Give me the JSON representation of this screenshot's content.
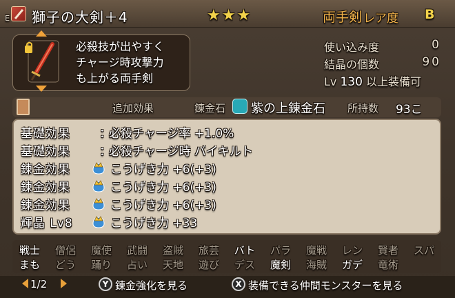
{
  "header": {
    "equip_mark": "E",
    "item_name": "獅子の大剣＋4",
    "stars": "★★★",
    "weapon_type": "両手剣",
    "rarity_label": "レア度",
    "rarity_value": "B"
  },
  "description": {
    "lines": [
      "必殺技が出やすく",
      "チャージ時攻撃力",
      "も上がる両手剣"
    ]
  },
  "stats": {
    "usage_label": "使い込み度",
    "usage_value": "0",
    "crystal_label": "結晶の個数",
    "crystal_value": "90",
    "lv_prefix": "Lv",
    "lv_value": "130",
    "lv_suffix": "以上装備可"
  },
  "alchemy_bar": {
    "tab_label": "追加効果",
    "stone_label": "錬金石",
    "stone_name": "紫の上錬金石",
    "owned_label": "所持数",
    "owned_value": "93こ"
  },
  "effects": [
    {
      "category": "基礎効果",
      "text": "必殺チャージ率 +1.0%",
      "icon": ""
    },
    {
      "category": "基礎効果",
      "text": "必殺チャージ時 バイキルト",
      "icon": ""
    },
    {
      "category": "錬金効果",
      "text": "こうげき力 +6(+3)",
      "icon": "slime-crown-icon"
    },
    {
      "category": "錬金効果",
      "text": "こうげき力 +6(+3)",
      "icon": "slime-crown-icon"
    },
    {
      "category": "錬金効果",
      "text": "こうげき力 +6(+3)",
      "icon": "slime-crown-icon"
    },
    {
      "category": "輝晶 Lv8",
      "text": "こうげき力 +33",
      "icon": "slime-crown-icon"
    }
  ],
  "jobs": {
    "row1": [
      {
        "name": "戦士",
        "on": true
      },
      {
        "name": "僧侶",
        "on": false
      },
      {
        "name": "魔使",
        "on": false
      },
      {
        "name": "武闘",
        "on": false
      },
      {
        "name": "盗賊",
        "on": false
      },
      {
        "name": "旅芸",
        "on": false
      },
      {
        "name": "バト",
        "on": true
      },
      {
        "name": "パラ",
        "on": false
      },
      {
        "name": "魔戦",
        "on": false
      },
      {
        "name": "レン",
        "on": false
      },
      {
        "name": "賢者",
        "on": false
      },
      {
        "name": "スパ",
        "on": false
      }
    ],
    "row2": [
      {
        "name": "まも",
        "on": true
      },
      {
        "name": "どう",
        "on": false
      },
      {
        "name": "踊り",
        "on": false
      },
      {
        "name": "占い",
        "on": false
      },
      {
        "name": "天地",
        "on": false
      },
      {
        "name": "遊び",
        "on": false
      },
      {
        "name": "デス",
        "on": false
      },
      {
        "name": "魔剣",
        "on": true
      },
      {
        "name": "海賊",
        "on": false
      },
      {
        "name": "ガデ",
        "on": true
      },
      {
        "name": "竜術",
        "on": false
      }
    ]
  },
  "footer": {
    "page": "1/2",
    "y_button": "Y",
    "y_action": "錬金強化を見る",
    "x_button": "X",
    "x_action": "装備できる仲間モンスターを見る"
  },
  "colors": {
    "gold": "#f2d24a",
    "orange": "#f0b24a",
    "accent_arrow": "#e8a13a",
    "stone_teal": "#28a9b6"
  }
}
